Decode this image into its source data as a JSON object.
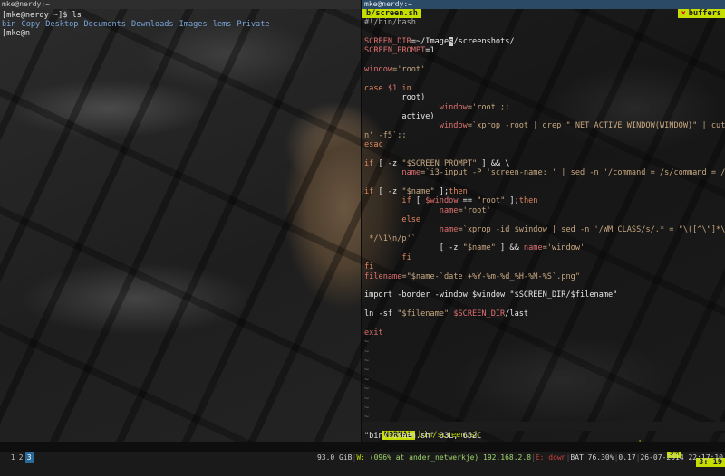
{
  "left_terminal": {
    "title": "mke@nerdy:~",
    "prompt_line": "[mke@nerdy ~]$ ls",
    "ls_entries": [
      {
        "name": "bin",
        "kind": "dir"
      },
      {
        "name": "Copy",
        "kind": "dir"
      },
      {
        "name": "Desktop",
        "kind": "dir"
      },
      {
        "name": "Documents",
        "kind": "dir"
      },
      {
        "name": "Downloads",
        "kind": "dir"
      },
      {
        "name": "Images",
        "kind": "dir"
      },
      {
        "name": "lems",
        "kind": "dir"
      },
      {
        "name": "Private",
        "kind": "dir"
      }
    ],
    "current_prompt": "[mke@n"
  },
  "right_terminal": {
    "title": "mke@nerdy:~",
    "tab_label": "b/screen.sh",
    "buffers_label": "buffers",
    "buffers_mark": "×",
    "code_lines": [
      [
        {
          "t": "#!/bin/bash",
          "c": "c"
        }
      ],
      [
        {
          "t": "",
          "c": "n"
        }
      ],
      [
        {
          "t": "SCREEN_DIR",
          "c": "v"
        },
        {
          "t": "=~/Image",
          "c": "n"
        },
        {
          "t": "s",
          "c": "hl"
        },
        {
          "t": "/screenshots/",
          "c": "n"
        }
      ],
      [
        {
          "t": "SCREEN_PROMPT",
          "c": "v"
        },
        {
          "t": "=1",
          "c": "n"
        }
      ],
      [
        {
          "t": "",
          "c": "n"
        }
      ],
      [
        {
          "t": "window",
          "c": "v"
        },
        {
          "t": "='root'",
          "c": "s"
        }
      ],
      [
        {
          "t": "",
          "c": "n"
        }
      ],
      [
        {
          "t": "case",
          "c": "k"
        },
        {
          "t": " $1 ",
          "c": "v"
        },
        {
          "t": "in",
          "c": "k"
        }
      ],
      [
        {
          "t": "        root)",
          "c": "n"
        }
      ],
      [
        {
          "t": "                window",
          "c": "v"
        },
        {
          "t": "='root';;",
          "c": "s"
        }
      ],
      [
        {
          "t": "        active)",
          "c": "n"
        }
      ],
      [
        {
          "t": "                window",
          "c": "v"
        },
        {
          "t": "=`xprop -root | grep \"_NET_ACTIVE_WINDOW(WINDOW)\" | cut -d' ' -",
          "c": "s"
        }
      ],
      [
        {
          "t": "n' -f5`;;",
          "c": "s"
        }
      ],
      [
        {
          "t": "esac",
          "c": "k"
        }
      ],
      [
        {
          "t": "",
          "c": "n"
        }
      ],
      [
        {
          "t": "if",
          "c": "k"
        },
        {
          "t": " [ -z ",
          "c": "n"
        },
        {
          "t": "\"$SCREEN_PROMPT\"",
          "c": "s"
        },
        {
          "t": " ] && \\",
          "c": "n"
        }
      ],
      [
        {
          "t": "        name",
          "c": "v"
        },
        {
          "t": "=`i3-input -P 'screen-name: ' | sed -n '/command = /s/command = //p",
          "c": "s"
        }
      ],
      [
        {
          "t": "",
          "c": "n"
        }
      ],
      [
        {
          "t": "if",
          "c": "k"
        },
        {
          "t": " [ -z ",
          "c": "n"
        },
        {
          "t": "\"$name\"",
          "c": "s"
        },
        {
          "t": " ];",
          "c": "n"
        },
        {
          "t": "then",
          "c": "k"
        }
      ],
      [
        {
          "t": "        if",
          "c": "k"
        },
        {
          "t": " [ ",
          "c": "n"
        },
        {
          "t": "$window",
          "c": "v"
        },
        {
          "t": " == ",
          "c": "n"
        },
        {
          "t": "\"root\"",
          "c": "s"
        },
        {
          "t": " ];",
          "c": "n"
        },
        {
          "t": "then",
          "c": "k"
        }
      ],
      [
        {
          "t": "                name",
          "c": "v"
        },
        {
          "t": "='root'",
          "c": "s"
        }
      ],
      [
        {
          "t": "        else",
          "c": "k"
        }
      ],
      [
        {
          "t": "                name",
          "c": "v"
        },
        {
          "t": "=`xprop -id $window | sed -n '/WM_CLASS/s/.* = \"\\([^\\\"]*\\)\"",
          "c": "s"
        }
      ],
      [
        {
          "t": " */\\1\\n/p'`",
          "c": "s"
        }
      ],
      [
        {
          "t": "                [ -z ",
          "c": "n"
        },
        {
          "t": "\"$name\"",
          "c": "s"
        },
        {
          "t": " ] && ",
          "c": "n"
        },
        {
          "t": "name",
          "c": "v"
        },
        {
          "t": "='window'",
          "c": "s"
        }
      ],
      [
        {
          "t": "        fi",
          "c": "k"
        }
      ],
      [
        {
          "t": "fi",
          "c": "k"
        }
      ],
      [
        {
          "t": "filename",
          "c": "v"
        },
        {
          "t": "=\"$name-`date +%Y-%m-%d_%H-%M-%S`.png\"",
          "c": "s"
        }
      ],
      [
        {
          "t": "",
          "c": "n"
        }
      ],
      [
        {
          "t": "import -border -window $window \"$SCREEN_DIR/$filename\"",
          "c": "n"
        }
      ],
      [
        {
          "t": "",
          "c": "n"
        }
      ],
      [
        {
          "t": "ln -sf ",
          "c": "n"
        },
        {
          "t": "\"$filename\"",
          "c": "s"
        },
        {
          "t": " $SCREEN_DIR",
          "c": "v"
        },
        {
          "t": "/last",
          "c": "n"
        }
      ],
      [
        {
          "t": "",
          "c": "n"
        }
      ],
      [
        {
          "t": "exit",
          "c": "v"
        }
      ]
    ],
    "tilde_count": 10,
    "tilde_char": "~",
    "statusline": {
      "mode": "NORMAL",
      "file": "bin/screen.sh",
      "filetype": "sh",
      "percent": "9%",
      "position": "3: 19"
    },
    "message": "\"bin/screen.sh\" 33L, 652C"
  },
  "bottom_bar": {
    "workspaces": [
      {
        "label": "1",
        "active": false
      },
      {
        "label": "2",
        "active": false
      },
      {
        "label": "3",
        "active": true
      }
    ],
    "disk": "93.0 GiB",
    "wifi_label": "W:",
    "wifi_info": "(096% at ander_netwerkje) 192.168.2.8",
    "eth_label": "E: down",
    "battery": "BAT 76.30%",
    "load": "0.17",
    "datetime": "26-07-2014 22:17:10"
  }
}
